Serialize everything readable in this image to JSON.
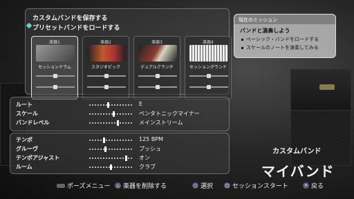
{
  "save_band_label": "カスタムバンドを保存する",
  "load_preset_label": "プリセットバンドをロードする",
  "slots": [
    {
      "header": "楽器1",
      "name": "セッションドラム",
      "color": "#6c6c6c"
    },
    {
      "header": "楽器2",
      "name": "スタジオピック",
      "color": "#b34a2a"
    },
    {
      "header": "楽器3",
      "name": "デュアルクランチ",
      "color": "#8a3d2e"
    },
    {
      "header": "楽器4",
      "name": "セッショングランド",
      "color": "#c8a26a"
    }
  ],
  "mission": {
    "header": "現在のミッション",
    "title": "バンドと演奏しよう",
    "items": [
      "ベーシック・バンドをロードする",
      "スケールのノートを演奏してみる"
    ]
  },
  "settings_top": [
    {
      "label": "ルート",
      "value": "E"
    },
    {
      "label": "スケール",
      "value": "ペンタトニックマイナー"
    },
    {
      "label": "バンドレベル",
      "value": "メインストリーム"
    }
  ],
  "settings_bottom": [
    {
      "label": "テンポ",
      "value": "125 BPM"
    },
    {
      "label": "グルーヴ",
      "value": "プッシュ"
    },
    {
      "label": "テンポアジャスト",
      "value": "オン"
    },
    {
      "label": "ルーム",
      "value": "クラブ"
    }
  ],
  "band": {
    "subtitle": "カスタムバンド",
    "name": "マイバンド"
  },
  "footer": {
    "pause": "ポーズメニュー",
    "remove": "楽器を削除する",
    "select": "選択",
    "start": "セッションスタート",
    "back": "戻る"
  }
}
